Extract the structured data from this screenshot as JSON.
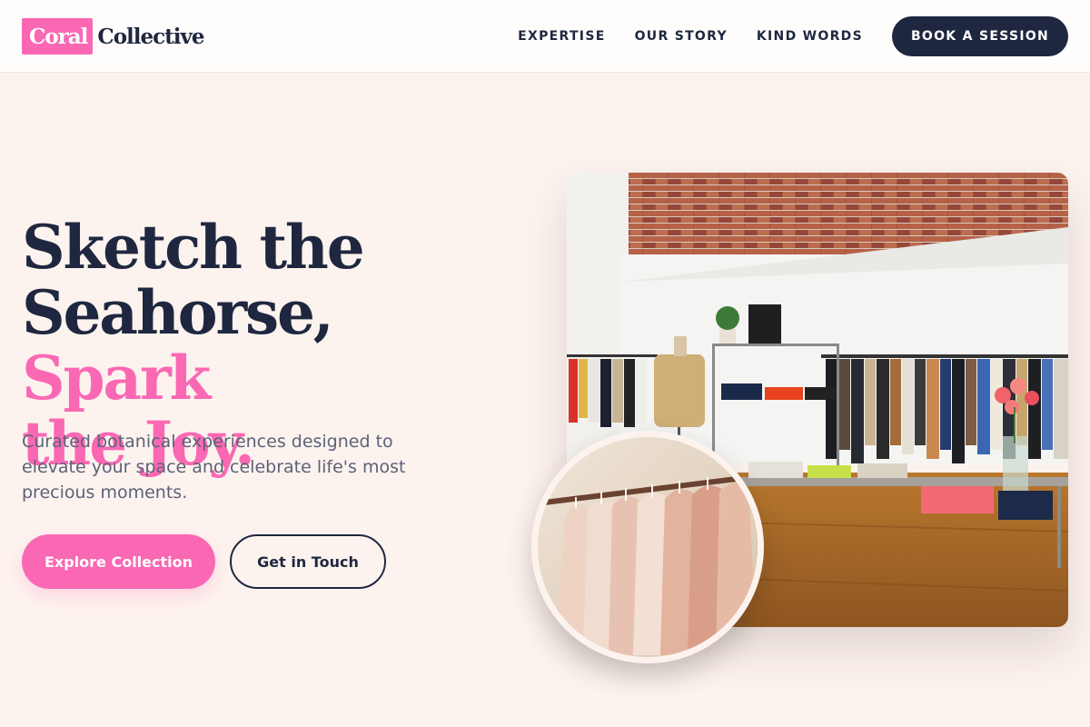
{
  "header": {
    "logo_highlight": "Coral",
    "logo_rest": "Collective",
    "nav": [
      "EXPERTISE",
      "OUR STORY",
      "KIND WORDS"
    ],
    "cta": "BOOK A SESSION"
  },
  "hero": {
    "headline_line1": "Sketch the",
    "headline_line2a": "Seahorse, ",
    "headline_line2b": "Spark",
    "headline_line3": "the Joy.",
    "lead": "Curated botanical experiences designed to elevate your space and celebrate life's most precious moments.",
    "primary_button": "Explore Collection",
    "secondary_button": "Get in Touch"
  },
  "images": {
    "main": "clothing-boutique-photo",
    "inset": "clothing-rack-photo"
  },
  "colors": {
    "accent": "#fa68b4",
    "navy": "#1f2740",
    "background": "#fdf3ee"
  }
}
